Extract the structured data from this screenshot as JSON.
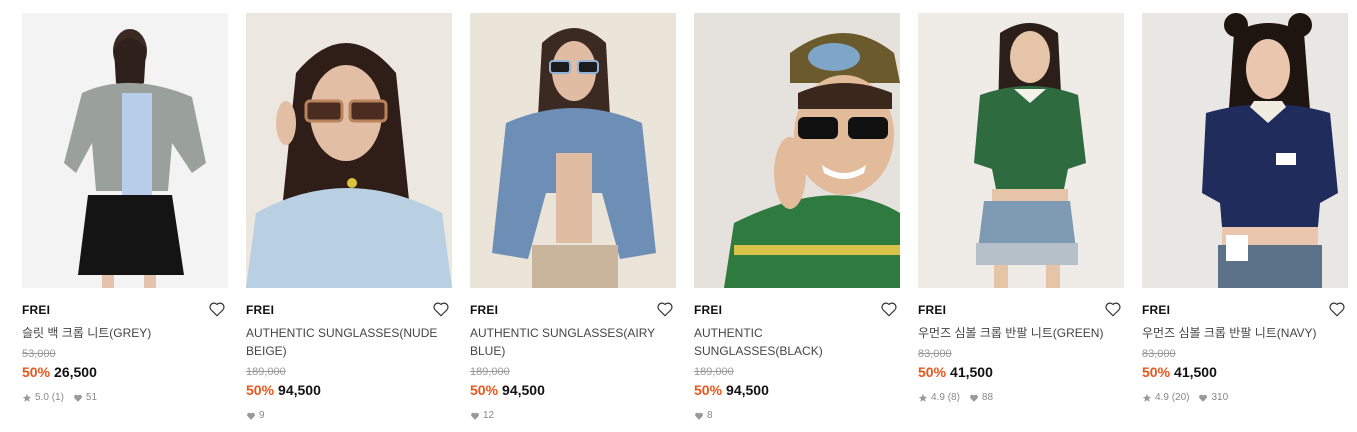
{
  "colors": {
    "discount": "#e8571c",
    "price": "#111111",
    "muted": "#999999"
  },
  "products": [
    {
      "brand": "FREI",
      "name": "슬릿 백 크롭 니트(GREY)",
      "original_price": "53,000",
      "discount": "50%",
      "price": "26,500",
      "rating": "5.0",
      "reviews": "(1)",
      "likes": "51",
      "image": "model-grey-knit-back-view"
    },
    {
      "brand": "FREI",
      "name": "AUTHENTIC SUNGLASSES(NUDE BEIGE)",
      "original_price": "189,000",
      "discount": "50%",
      "price": "94,500",
      "rating": "",
      "reviews": "",
      "likes": "9",
      "image": "model-beige-sunglasses"
    },
    {
      "brand": "FREI",
      "name": "AUTHENTIC SUNGLASSES(AIRY BLUE)",
      "original_price": "189,000",
      "discount": "50%",
      "price": "94,500",
      "rating": "",
      "reviews": "",
      "likes": "12",
      "image": "model-blue-sunglasses-denim"
    },
    {
      "brand": "FREI",
      "name": "AUTHENTIC SUNGLASSES(BLACK)",
      "original_price": "189,000",
      "discount": "50%",
      "price": "94,500",
      "rating": "",
      "reviews": "",
      "likes": "8",
      "image": "model-black-sunglasses-cap"
    },
    {
      "brand": "FREI",
      "name": "우먼즈 심볼 크롭 반팔 니트(GREEN)",
      "original_price": "83,000",
      "discount": "50%",
      "price": "41,500",
      "rating": "4.9",
      "reviews": "(8)",
      "likes": "88",
      "image": "model-green-knit"
    },
    {
      "brand": "FREI",
      "name": "우먼즈 심볼 크롭 반팔 니트(NAVY)",
      "original_price": "83,000",
      "discount": "50%",
      "price": "41,500",
      "rating": "4.9",
      "reviews": "(20)",
      "likes": "310",
      "image": "model-navy-knit"
    }
  ]
}
